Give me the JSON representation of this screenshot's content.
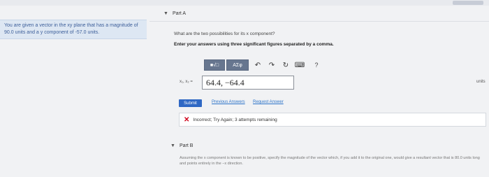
{
  "problem": {
    "text": "You are given a vector in the xy plane that has a magnitude of 90.0 units and a y component of -57.0 units."
  },
  "partA": {
    "title": "Part A",
    "question": "What are the two possibilities for its x component?",
    "instruction": "Enter your answers using three significant figures separated by a comma.",
    "toolbar": {
      "sqrt_label": "■√□",
      "symbols_label": "AΣφ",
      "undo_icon": "undo-icon",
      "redo_icon": "redo-icon",
      "reset_icon": "reset-icon",
      "keyboard_icon": "keyboard-icon",
      "help_label": "?"
    },
    "answer_label": "x₁, x₂ =",
    "answer_value": "64.4, −64.4",
    "unit_label": "units",
    "submit_label": "Submit",
    "previous_answers_label": "Previous Answers",
    "request_answer_label": "Request Answer",
    "feedback": "Incorrect; Try Again; 3 attempts remaining"
  },
  "partB": {
    "title": "Part B",
    "text": "Assuming the x component is known to be positive, specify the magnitude of the vector which, if you add it to the original one, would give a resultant vector that is 80.0 units long and points entirely in the −x direction."
  },
  "colors": {
    "accent": "#2f68c4",
    "error": "#d0021b",
    "toolbar": "#67768f"
  }
}
